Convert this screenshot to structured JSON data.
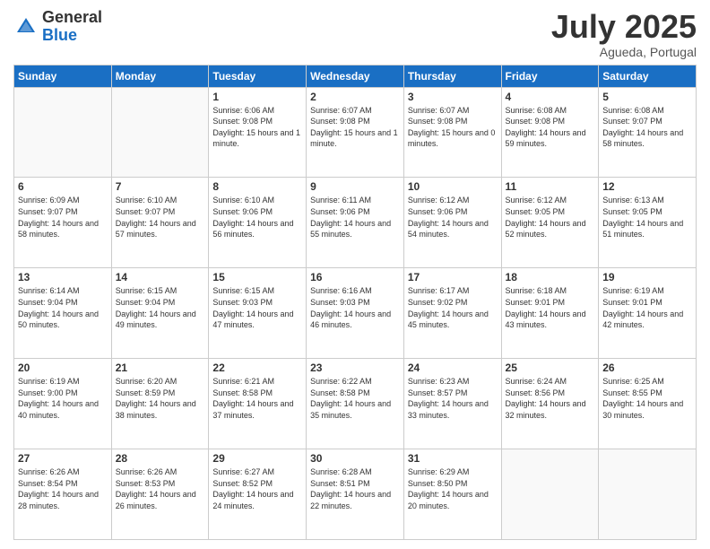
{
  "header": {
    "logo_general": "General",
    "logo_blue": "Blue",
    "title": "July 2025",
    "subtitle": "Agueda, Portugal"
  },
  "weekdays": [
    "Sunday",
    "Monday",
    "Tuesday",
    "Wednesday",
    "Thursday",
    "Friday",
    "Saturday"
  ],
  "weeks": [
    [
      {
        "day": "",
        "info": ""
      },
      {
        "day": "",
        "info": ""
      },
      {
        "day": "1",
        "info": "Sunrise: 6:06 AM\nSunset: 9:08 PM\nDaylight: 15 hours and 1 minute."
      },
      {
        "day": "2",
        "info": "Sunrise: 6:07 AM\nSunset: 9:08 PM\nDaylight: 15 hours and 1 minute."
      },
      {
        "day": "3",
        "info": "Sunrise: 6:07 AM\nSunset: 9:08 PM\nDaylight: 15 hours and 0 minutes."
      },
      {
        "day": "4",
        "info": "Sunrise: 6:08 AM\nSunset: 9:08 PM\nDaylight: 14 hours and 59 minutes."
      },
      {
        "day": "5",
        "info": "Sunrise: 6:08 AM\nSunset: 9:07 PM\nDaylight: 14 hours and 58 minutes."
      }
    ],
    [
      {
        "day": "6",
        "info": "Sunrise: 6:09 AM\nSunset: 9:07 PM\nDaylight: 14 hours and 58 minutes."
      },
      {
        "day": "7",
        "info": "Sunrise: 6:10 AM\nSunset: 9:07 PM\nDaylight: 14 hours and 57 minutes."
      },
      {
        "day": "8",
        "info": "Sunrise: 6:10 AM\nSunset: 9:06 PM\nDaylight: 14 hours and 56 minutes."
      },
      {
        "day": "9",
        "info": "Sunrise: 6:11 AM\nSunset: 9:06 PM\nDaylight: 14 hours and 55 minutes."
      },
      {
        "day": "10",
        "info": "Sunrise: 6:12 AM\nSunset: 9:06 PM\nDaylight: 14 hours and 54 minutes."
      },
      {
        "day": "11",
        "info": "Sunrise: 6:12 AM\nSunset: 9:05 PM\nDaylight: 14 hours and 52 minutes."
      },
      {
        "day": "12",
        "info": "Sunrise: 6:13 AM\nSunset: 9:05 PM\nDaylight: 14 hours and 51 minutes."
      }
    ],
    [
      {
        "day": "13",
        "info": "Sunrise: 6:14 AM\nSunset: 9:04 PM\nDaylight: 14 hours and 50 minutes."
      },
      {
        "day": "14",
        "info": "Sunrise: 6:15 AM\nSunset: 9:04 PM\nDaylight: 14 hours and 49 minutes."
      },
      {
        "day": "15",
        "info": "Sunrise: 6:15 AM\nSunset: 9:03 PM\nDaylight: 14 hours and 47 minutes."
      },
      {
        "day": "16",
        "info": "Sunrise: 6:16 AM\nSunset: 9:03 PM\nDaylight: 14 hours and 46 minutes."
      },
      {
        "day": "17",
        "info": "Sunrise: 6:17 AM\nSunset: 9:02 PM\nDaylight: 14 hours and 45 minutes."
      },
      {
        "day": "18",
        "info": "Sunrise: 6:18 AM\nSunset: 9:01 PM\nDaylight: 14 hours and 43 minutes."
      },
      {
        "day": "19",
        "info": "Sunrise: 6:19 AM\nSunset: 9:01 PM\nDaylight: 14 hours and 42 minutes."
      }
    ],
    [
      {
        "day": "20",
        "info": "Sunrise: 6:19 AM\nSunset: 9:00 PM\nDaylight: 14 hours and 40 minutes."
      },
      {
        "day": "21",
        "info": "Sunrise: 6:20 AM\nSunset: 8:59 PM\nDaylight: 14 hours and 38 minutes."
      },
      {
        "day": "22",
        "info": "Sunrise: 6:21 AM\nSunset: 8:58 PM\nDaylight: 14 hours and 37 minutes."
      },
      {
        "day": "23",
        "info": "Sunrise: 6:22 AM\nSunset: 8:58 PM\nDaylight: 14 hours and 35 minutes."
      },
      {
        "day": "24",
        "info": "Sunrise: 6:23 AM\nSunset: 8:57 PM\nDaylight: 14 hours and 33 minutes."
      },
      {
        "day": "25",
        "info": "Sunrise: 6:24 AM\nSunset: 8:56 PM\nDaylight: 14 hours and 32 minutes."
      },
      {
        "day": "26",
        "info": "Sunrise: 6:25 AM\nSunset: 8:55 PM\nDaylight: 14 hours and 30 minutes."
      }
    ],
    [
      {
        "day": "27",
        "info": "Sunrise: 6:26 AM\nSunset: 8:54 PM\nDaylight: 14 hours and 28 minutes."
      },
      {
        "day": "28",
        "info": "Sunrise: 6:26 AM\nSunset: 8:53 PM\nDaylight: 14 hours and 26 minutes."
      },
      {
        "day": "29",
        "info": "Sunrise: 6:27 AM\nSunset: 8:52 PM\nDaylight: 14 hours and 24 minutes."
      },
      {
        "day": "30",
        "info": "Sunrise: 6:28 AM\nSunset: 8:51 PM\nDaylight: 14 hours and 22 minutes."
      },
      {
        "day": "31",
        "info": "Sunrise: 6:29 AM\nSunset: 8:50 PM\nDaylight: 14 hours and 20 minutes."
      },
      {
        "day": "",
        "info": ""
      },
      {
        "day": "",
        "info": ""
      }
    ]
  ]
}
